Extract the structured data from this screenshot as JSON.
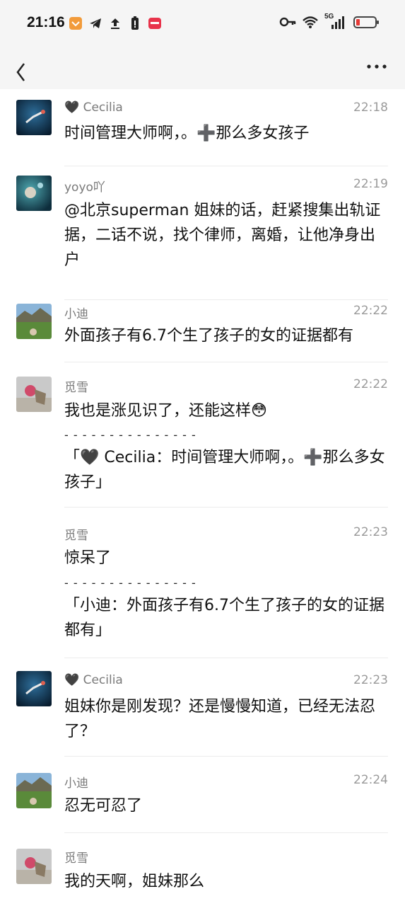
{
  "status_bar": {
    "time": "21:16",
    "network": "5G"
  },
  "header": {
    "back_icon": "chevron-left-icon",
    "more_icon": "more-horizontal-icon"
  },
  "messages": [
    {
      "name": "🖤 Cecilia",
      "time": "22:18",
      "text": "时间管理大师啊，。➕那么多女孩子"
    },
    {
      "name": "yoyo吖",
      "time": "22:19",
      "text": "@北京superman 姐妹的话，赶紧搜集出轨证据，二话不说，找个律师，离婚，让他净身出户"
    },
    {
      "name": "小迪",
      "time": "22:22",
      "text": "外面孩子有6.7个生了孩子的女的证据都有"
    },
    {
      "name": "觅雪",
      "time": "22:22",
      "text": "我也是涨见识了，还能这样😳",
      "separator": "- - - - - - - - - - - - - - -",
      "quote": "「🖤 Cecilia：时间管理大师啊，。➕那么多女孩子」"
    },
    {
      "name": "觅雪",
      "time": "22:23",
      "text": "惊呆了",
      "separator": "- - - - - - - - - - - - - - -",
      "quote": "「小迪：外面孩子有6.7个生了孩子的女的证据都有」"
    },
    {
      "name": "🖤 Cecilia",
      "time": "22:23",
      "text": "姐妹你是刚发现？还是慢慢知道，已经无法忍了？"
    },
    {
      "name": "小迪",
      "time": "22:24",
      "text": "忍无可忍了"
    },
    {
      "name": "觅雪",
      "time": "",
      "text": "我的天啊，姐妹那么"
    }
  ]
}
